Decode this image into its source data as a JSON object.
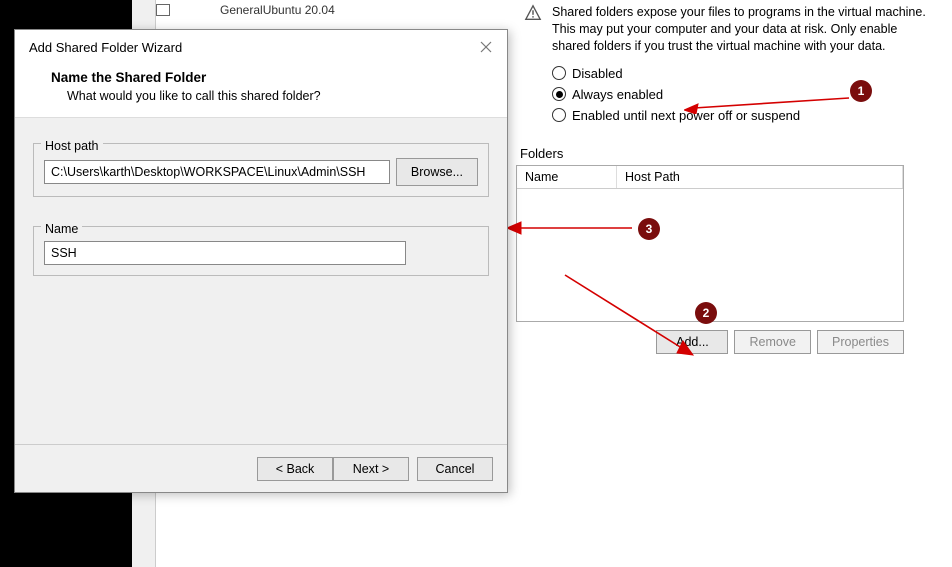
{
  "background": {
    "tree_item": "General",
    "tree_value": "Ubuntu 20.04"
  },
  "right_panel": {
    "warning_text": "Shared folders expose your files to programs in the virtual machine. This may put your computer and your data at risk. Only enable shared folders if you trust the virtual machine with your data.",
    "radios": {
      "disabled": "Disabled",
      "always": "Always enabled",
      "until_off": "Enabled until next power off or suspend",
      "selected": "always"
    },
    "folders": {
      "label": "Folders",
      "columns": {
        "name": "Name",
        "host": "Host Path"
      },
      "rows": []
    },
    "buttons": {
      "add": "Add...",
      "remove": "Remove",
      "properties": "Properties"
    }
  },
  "wizard": {
    "title": "Add Shared Folder Wizard",
    "heading": "Name the Shared Folder",
    "subheading": "What would you like to call this shared folder?",
    "host_path": {
      "label": "Host path",
      "value": "C:\\Users\\karth\\Desktop\\WORKSPACE\\Linux\\Admin\\SSH",
      "browse": "Browse..."
    },
    "name": {
      "label": "Name",
      "value": "SSH"
    },
    "footer": {
      "back": "< Back",
      "next": "Next >",
      "cancel": "Cancel"
    }
  },
  "annotations": {
    "badge1": "1",
    "badge2": "2",
    "badge3": "3"
  }
}
